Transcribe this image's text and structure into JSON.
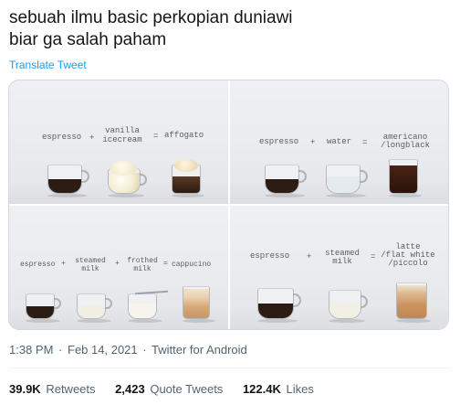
{
  "tweet": {
    "line1": "sebuah ilmu basic perkopian duniawi",
    "line2": "biar ga salah paham",
    "translate": "Translate Tweet"
  },
  "panels": {
    "p1": {
      "a": "espresso",
      "plus": "+",
      "b1": "vanilla",
      "b2": "icecream",
      "eq": "=",
      "r": "affogato"
    },
    "p2": {
      "a": "espresso",
      "plus": "+",
      "b": "water",
      "eq": "=",
      "r1": "americano",
      "r2": "/longblack"
    },
    "p3": {
      "a": "espresso",
      "plus1": "+",
      "b1": "steamed",
      "b2": "milk",
      "plus2": "+",
      "c1": "frothed",
      "c2": "milk",
      "eq": "=",
      "r": "cappucino"
    },
    "p4": {
      "a": "espresso",
      "plus": "+",
      "b1": "steamed",
      "b2": "milk",
      "eq": "=",
      "r1": "latte",
      "r2": "/flat white",
      "r3": "/piccolo"
    }
  },
  "meta": {
    "time": "1:38 PM",
    "dot1": "·",
    "date": "Feb 14, 2021",
    "dot2": "·",
    "source": "Twitter for Android"
  },
  "stats": {
    "retweets_count": "39.9K",
    "retweets_label": "Retweets",
    "quotes_count": "2,423",
    "quotes_label": "Quote Tweets",
    "likes_count": "122.4K",
    "likes_label": "Likes"
  },
  "colors": {
    "link": "#1d9bf0",
    "espresso": "#2b1d14",
    "americano": "#3a1f12",
    "milk": "#f3f0e6",
    "latte": "#c98f5d"
  }
}
